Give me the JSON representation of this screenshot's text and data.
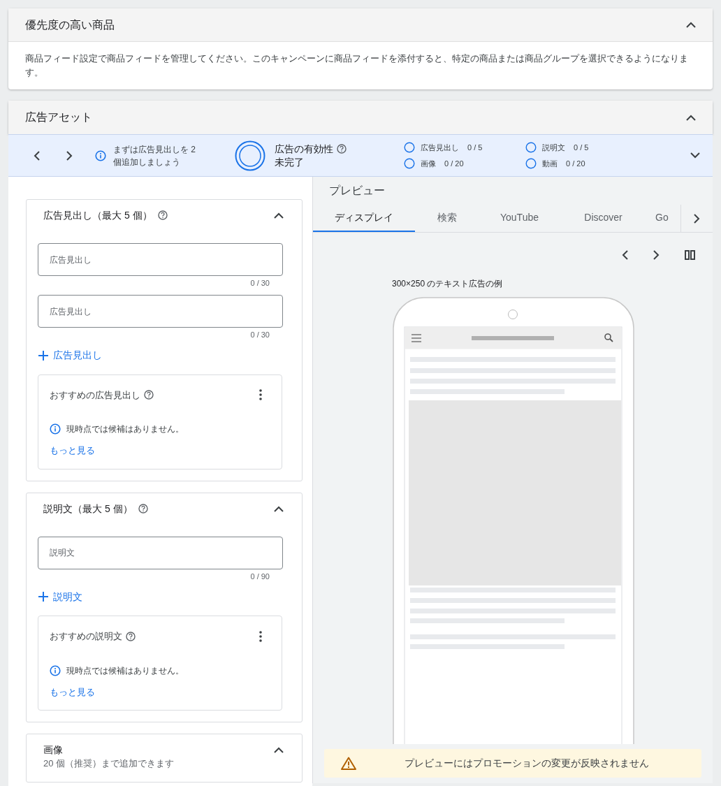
{
  "priority_products": {
    "title": "優先度の高い商品",
    "expanded": true,
    "description": "商品フィード設定で商品フィードを管理してください。このキャンペーンに商品フィードを添付すると、特定の商品または商品グループを選択できるようになります。"
  },
  "ad_assets": {
    "title": "広告アセット",
    "expanded": true
  },
  "effectiveness_bar": {
    "hint": "まずは広告見出しを 2 個追加しましょう",
    "title": "広告の有効性",
    "status": "未完了",
    "items": [
      {
        "label": "広告見出し",
        "count": "0 / 5",
        "done": false
      },
      {
        "label": "説明文",
        "count": "0 / 5",
        "done": false
      },
      {
        "label": "画像",
        "count": "0 / 20",
        "done": false
      },
      {
        "label": "動画",
        "count": "0 / 20",
        "done": false
      }
    ]
  },
  "sections": [
    {
      "title": "広告見出し（最大 5 個）",
      "expanded": true,
      "fields": [
        {
          "placeholder": "広告見出し",
          "counter": "0 / 30"
        },
        {
          "placeholder": "広告見出し",
          "counter": "0 / 30"
        }
      ],
      "add_label": "広告見出し",
      "suggestions": {
        "title": "おすすめの広告見出し",
        "message": "現時点では候補はありません。",
        "link": "もっと見る"
      }
    },
    {
      "title": "説明文（最大 5 個）",
      "expanded": true,
      "fields": [
        {
          "placeholder": "説明文",
          "counter": "0 / 90"
        }
      ],
      "add_label": "説明文",
      "suggestions": {
        "title": "おすすめの説明文",
        "message": "現時点では候補はありません。",
        "link": "もっと見る"
      }
    },
    {
      "title": "画像",
      "subtitle": "20 個（推奨）まで追加できます",
      "expanded": true
    }
  ],
  "preview": {
    "title": "プレビュー",
    "tabs": [
      {
        "label": "ディスプレイ",
        "selected": true
      },
      {
        "label": "検索",
        "selected": false
      },
      {
        "label": "YouTube",
        "selected": false
      },
      {
        "label": "Discover",
        "selected": false
      },
      {
        "label": "Go",
        "selected": false
      }
    ],
    "caption": "300×250 のテキスト広告の例",
    "warning": "プレビューにはプロモーションの変更が反映されません"
  }
}
